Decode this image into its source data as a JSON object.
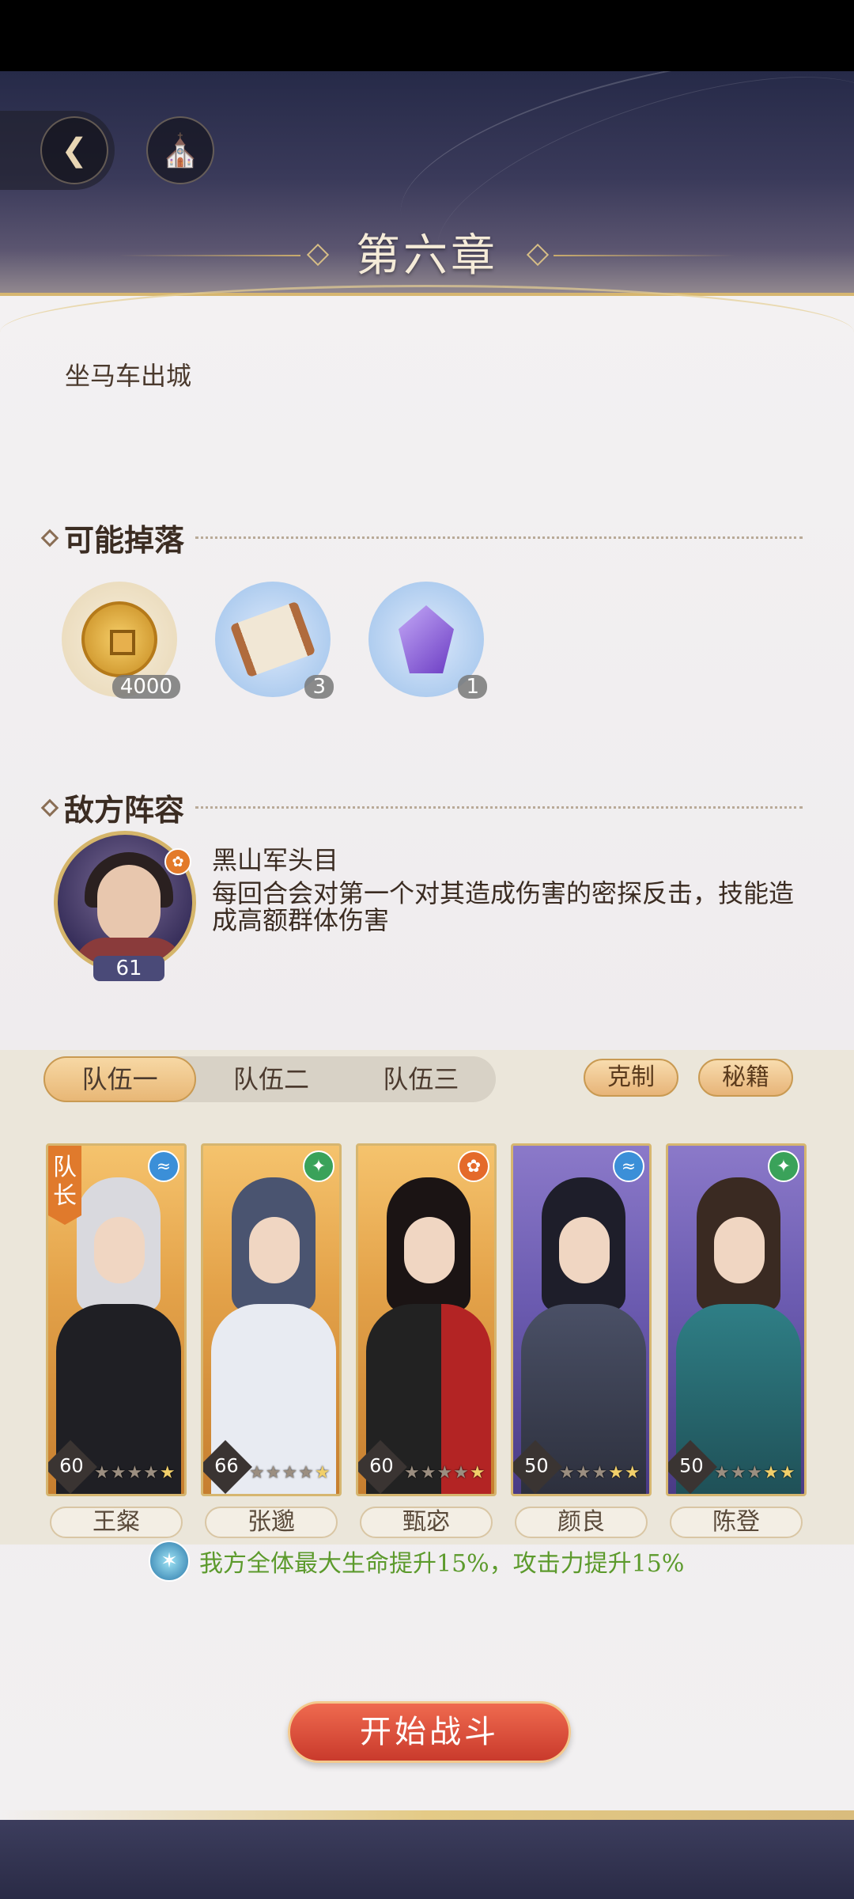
{
  "chapter": {
    "title": "第六章"
  },
  "stage": {
    "description": "坐马车出城"
  },
  "drops": {
    "heading": "可能掉落",
    "items": [
      {
        "icon": "coin-icon",
        "count": "4000"
      },
      {
        "icon": "scroll-icon",
        "count": "3"
      },
      {
        "icon": "crystal-icon",
        "count": "1"
      }
    ]
  },
  "enemy": {
    "heading": "敌方阵容",
    "name": "黑山军头目",
    "level": "61",
    "skill": "每回合会对第一个对其造成伤害的密探反击，技能造成高额群体伤害"
  },
  "team": {
    "tabs": [
      "队伍一",
      "队伍二",
      "队伍三"
    ],
    "active_tab": 0,
    "counter_label": "克制",
    "secret_label": "秘籍",
    "captain_label": "队长",
    "members": [
      {
        "name": "王粲",
        "level": "60",
        "element": "water",
        "stars": 5,
        "filled_stars": 1,
        "frame": "gold"
      },
      {
        "name": "张邈",
        "level": "66",
        "element": "wood",
        "stars": 5,
        "filled_stars": 1,
        "frame": "gold"
      },
      {
        "name": "甄宓",
        "level": "60",
        "element": "fire",
        "stars": 5,
        "filled_stars": 1,
        "frame": "gold"
      },
      {
        "name": "颜良",
        "level": "50",
        "element": "water",
        "stars": 5,
        "filled_stars": 2,
        "frame": "purple"
      },
      {
        "name": "陈登",
        "level": "50",
        "element": "wood",
        "stars": 5,
        "filled_stars": 2,
        "frame": "purple"
      }
    ],
    "buff": "我方全体最大生命提升15%，攻击力提升15%"
  },
  "actions": {
    "start_label": "开始战斗"
  }
}
